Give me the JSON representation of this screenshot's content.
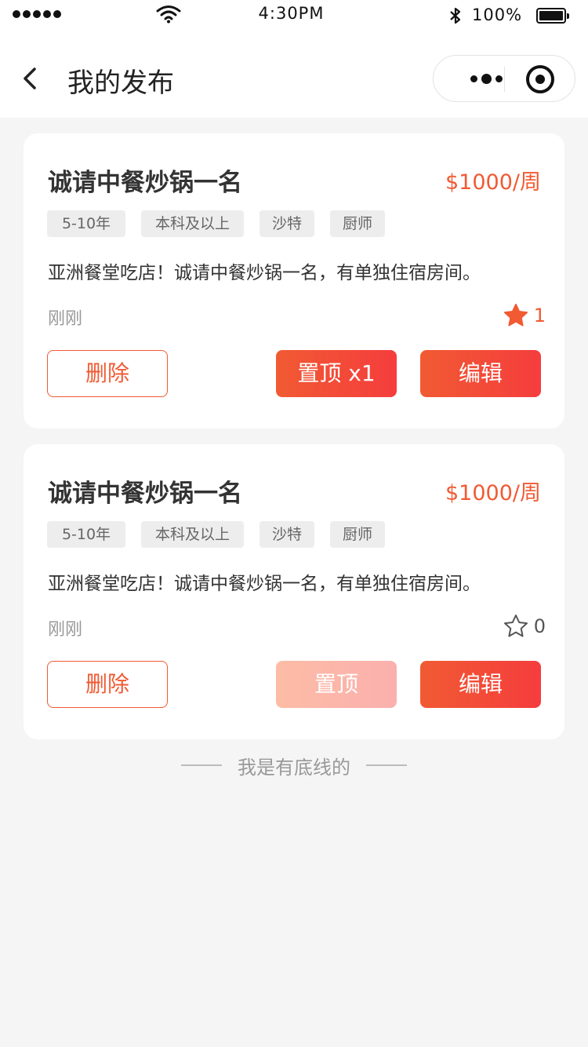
{
  "status_bar": {
    "time": "4:30PM",
    "battery": "100%",
    "icons": [
      "signal-dots-icon",
      "wifi-icon",
      "bluetooth-icon",
      "battery-icon"
    ]
  },
  "nav": {
    "title": "我的发布",
    "back_icon": "chevron-left-icon",
    "menu_icon": "more-dots-icon",
    "close_icon": "target-icon"
  },
  "posts": [
    {
      "title": "诚请中餐炒锅一名",
      "salary": "$1000/周",
      "tags": [
        "5-10年",
        "本科及以上",
        "沙特",
        "厨师"
      ],
      "description": "亚洲餐堂吃店！诚请中餐炒锅一名，有单独住宿房间。",
      "time": "刚刚",
      "favorite_count": "1",
      "favorited": true,
      "delete_label": "删除",
      "top_label": "置顶 x1",
      "top_enabled": true,
      "edit_label": "编辑"
    },
    {
      "title": "诚请中餐炒锅一名",
      "salary": "$1000/周",
      "tags": [
        "5-10年",
        "本科及以上",
        "沙特",
        "厨师"
      ],
      "description": "亚洲餐堂吃店！诚请中餐炒锅一名，有单独住宿房间。",
      "time": "刚刚",
      "favorite_count": "0",
      "favorited": false,
      "delete_label": "删除",
      "top_label": "置顶",
      "top_enabled": false,
      "edit_label": "编辑"
    }
  ],
  "footer": {
    "text": "我是有底线的"
  },
  "colors": {
    "accent": "#f15a33",
    "accent_end": "#f53d3d",
    "background": "#f5f5f5"
  }
}
